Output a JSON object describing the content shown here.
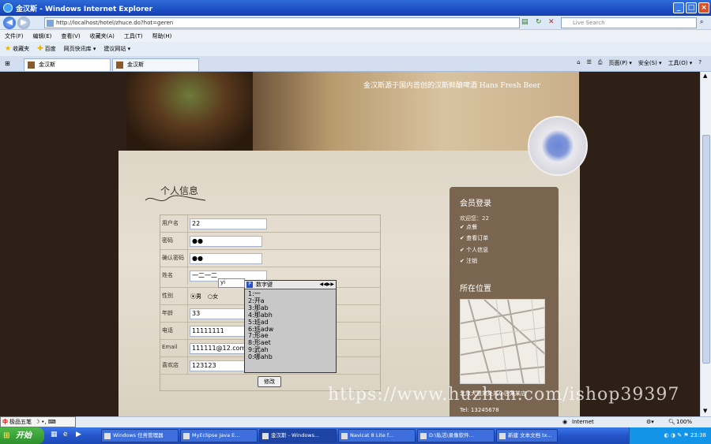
{
  "window": {
    "title": "金汉斯 - Windows Internet Explorer"
  },
  "address_bar": {
    "url": "http://localhost/hotel/zhuce.do?hot=geren",
    "search_placeholder": "Live Search"
  },
  "menu": [
    "文件(F)",
    "编辑(E)",
    "查看(V)",
    "收藏夹(A)",
    "工具(T)",
    "帮助(H)"
  ],
  "favorites_bar": [
    "收藏夹",
    "百度",
    "网页快讯库 ▾",
    "建议网站 ▾"
  ],
  "tabs": [
    "金汉斯",
    "金汉斯"
  ],
  "command_bar": [
    "页面(P) ▾",
    "安全(S) ▾",
    "工具(O) ▾"
  ],
  "page": {
    "slogan": "金汉斯源于国内首创的汉斯鲜酿啤酒 Hans Fresh Beer",
    "title": "个人信息",
    "form": {
      "rows": [
        {
          "label": "用户名",
          "value": "22"
        },
        {
          "label": "密码",
          "value": "●●"
        },
        {
          "label": "确认密码",
          "value": "●●"
        },
        {
          "label": "姓名",
          "value": "一二一二"
        },
        {
          "label": "性别",
          "value": ""
        },
        {
          "label": "年龄",
          "value": "33"
        },
        {
          "label": "电话",
          "value": "11111111"
        },
        {
          "label": "Email",
          "value": "111111@12.com"
        },
        {
          "label": "喜欢店",
          "value": "123123"
        }
      ],
      "gender_male": "男",
      "gender_female": "女",
      "submit": "修改"
    },
    "sidebar": {
      "title": "会员登录",
      "welcome": "欢迎您：22",
      "links": [
        "点餐",
        "查看订单",
        "个人信息",
        "注销"
      ],
      "location_title": "所在位置",
      "address": "北京大道某处某小区某某店",
      "tel": "Tel: 13245678"
    }
  },
  "ime_popup": {
    "title": "数字键",
    "input": "yi",
    "candidates": [
      "1:一",
      "2:开a",
      "3:那ab",
      "4:那abh",
      "5:班ad",
      "6:班adw",
      "7:形ae",
      "8:形aet",
      "9:武ah",
      "0:哪ahb"
    ]
  },
  "watermark": "https://www.huzhan.com/ishop39397",
  "status": {
    "zone": "Internet",
    "zoom": "100%"
  },
  "ime_bar": {
    "name": "极品五笔"
  },
  "taskbar": {
    "start": "开始",
    "items": [
      "Windows 任务管理器",
      "MyEclipse Java E...",
      "金汉斯 - Windows...",
      "Navicat 8 Lite f...",
      "D:\\私活\\录像软件...",
      "新建 文本文档 tx..."
    ],
    "clock": "23:38"
  }
}
